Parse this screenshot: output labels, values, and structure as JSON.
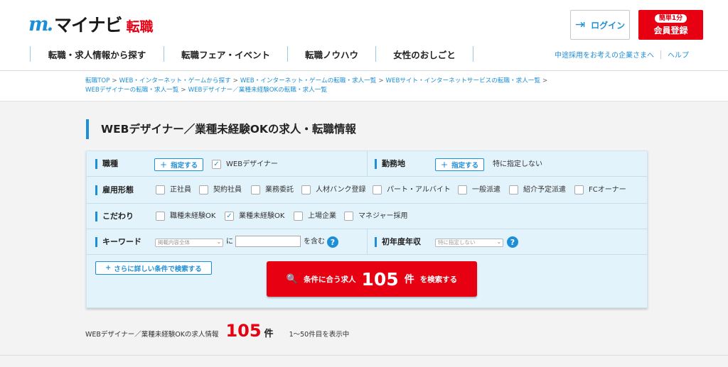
{
  "header": {
    "logo_mark": "m.",
    "logo_name": "マイナビ",
    "logo_sub": "転職",
    "login_label": "ログイン",
    "register_pill": "簡単1分",
    "register_label": "会員登録",
    "nav": [
      "転職・求人情報から探す",
      "転職フェア・イベント",
      "転職ノウハウ",
      "女性のおしごと"
    ],
    "subnav": [
      "中途採用をお考えの企業さまへ",
      "ヘルプ"
    ]
  },
  "breadcrumb": [
    "転職TOP",
    "WEB・インターネット・ゲームから探す",
    "WEB・インターネット・ゲームの転職・求人一覧",
    "WEBサイト・インターネットサービスの転職・求人一覧",
    "WEBデザイナーの転職・求人一覧",
    "WEBデザイナー／業種未経験OKの転職・求人一覧"
  ],
  "page_title": "WEBデザイナー／業種未経験OKの求人・転職情報",
  "search": {
    "job_type": {
      "label": "職種",
      "button": "指定する",
      "selected": "WEBデザイナー",
      "checked": true
    },
    "location": {
      "label": "勤務地",
      "button": "指定する",
      "value": "特に指定しない"
    },
    "employment": {
      "label": "雇用形態",
      "options": [
        "正社員",
        "契約社員",
        "業務委託",
        "人材バンク登録",
        "パート・アルバイト",
        "一般派遣",
        "紹介予定派遣",
        "FCオーナー"
      ],
      "checked": [
        false,
        false,
        false,
        false,
        false,
        false,
        false,
        false
      ]
    },
    "preference": {
      "label": "こだわり",
      "options": [
        "職種未経験OK",
        "業種未経験OK",
        "上場企業",
        "マネジャー採用"
      ],
      "checked": [
        false,
        true,
        false,
        false
      ]
    },
    "keyword": {
      "label": "キーワード",
      "select_value": "掲載内容全体",
      "joiner": "に",
      "input_value": "",
      "suffix": "を含む"
    },
    "salary": {
      "label": "初年度年収",
      "select_value": "特に指定しない"
    },
    "more_button": "さらに詳しい条件で検索する",
    "submit": {
      "prefix": "条件に合う求人",
      "count": "105",
      "unit": "件",
      "suffix": "を検索する"
    }
  },
  "result": {
    "text": "WEBデザイナー／業種未経験OKの求人情報",
    "count": "105",
    "unit": "件",
    "range": "1〜50件目を表示中"
  }
}
